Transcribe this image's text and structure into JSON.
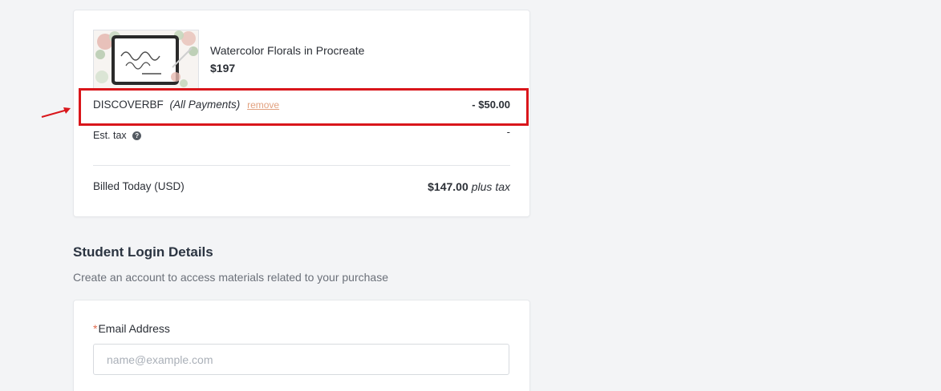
{
  "order": {
    "product": {
      "image_alt": "Watercolor Florals in Procreate",
      "title": "Watercolor Florals in Procreate",
      "price": "$197"
    },
    "coupon": {
      "code": "DISCOVERBF",
      "scope": "(All Payments)",
      "remove_label": "remove",
      "amount": "- $50.00"
    },
    "tax": {
      "label": "Est. tax",
      "help_icon": "question-circle-icon",
      "value": "-"
    },
    "total": {
      "label": "Billed Today (USD)",
      "amount": "$147.00",
      "suffix": "plus tax"
    }
  },
  "annotation": {
    "highlight_color": "#d9161b",
    "arrow_icon": "red-arrow-icon"
  },
  "student_login": {
    "title": "Student Login Details",
    "subtitle": "Create an account to access materials related to your purchase",
    "email": {
      "required_mark": "*",
      "label": "Email Address",
      "placeholder": "name@example.com",
      "value": ""
    }
  },
  "colors": {
    "background": "#f3f4f6",
    "card": "#ffffff",
    "remove_link": "#e2a17f",
    "required": "#e06c4f"
  }
}
